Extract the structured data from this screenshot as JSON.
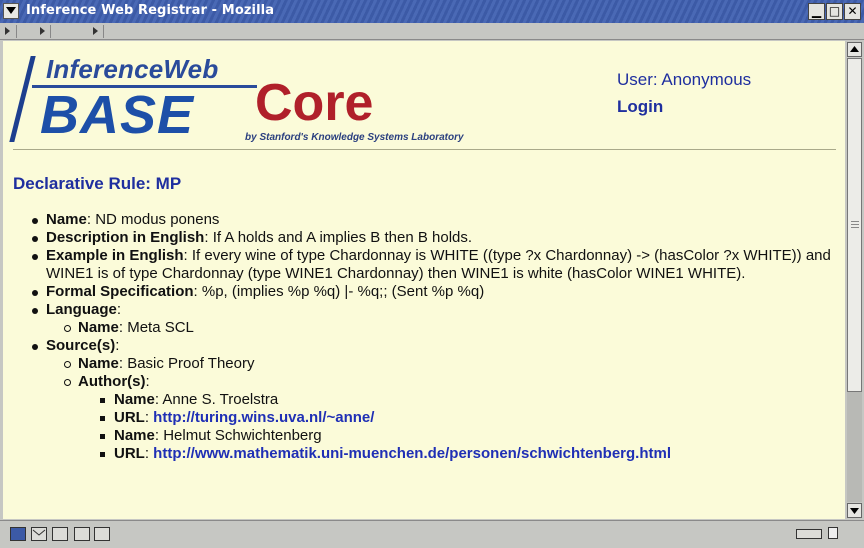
{
  "window": {
    "title": "Inference Web Registrar - Mozilla",
    "min_glyph": "▁",
    "max_glyph": "□",
    "close_glyph": "✕"
  },
  "header": {
    "logo_text_top": "InferenceWeb",
    "logo_text_base": "BASE",
    "logo_text_core": "Core",
    "logo_tagline": "by Stanford's Knowledge Systems Laboratory",
    "user": "User: Anonymous",
    "login": "Login"
  },
  "page": {
    "heading": "Declarative Rule: MP",
    "name_label": "Name",
    "name_value": ": ND modus ponens",
    "desc_label": "Description in English",
    "desc_value": ": If A holds and A implies B then B holds.",
    "example_label": "Example in English",
    "example_value": ": If every wine of type Chardonnay is WHITE ((type ?x Chardonnay) -> (hasColor ?x WHITE)) and WINE1 is of type Chardonnay (type WINE1 Chardonnay) then WINE1 is white (hasColor WINE1 WHITE).",
    "formal_label": "Formal Specification",
    "formal_value": ": %p, (implies %p %q) |- %q;; (Sent %p %q)",
    "language_label": "Language",
    "language_colon": ":",
    "language_name_label": "Name",
    "language_name_value": ": Meta SCL",
    "source_label": "Source(s)",
    "source_colon": ":",
    "source_name_label": "Name",
    "source_name_value": ": Basic Proof Theory",
    "authors_label": "Author(s)",
    "authors_colon": ":",
    "authors": [
      {
        "name_label": "Name",
        "name_value": ": Anne S. Troelstra",
        "url_label": "URL",
        "url_sep": ": ",
        "url": "http://turing.wins.uva.nl/~anne/"
      },
      {
        "name_label": "Name",
        "name_value": ": Helmut Schwichtenberg",
        "url_label": "URL",
        "url_sep": ": ",
        "url": "http://www.mathematik.uni-muenchen.de/personen/schwichtenberg.html"
      }
    ]
  },
  "colors": {
    "content_bg": "#fbfbd9",
    "link": "#1f2fb5",
    "heading": "#1f2f9f",
    "logo_red": "#b0202a",
    "logo_blue": "#1d4fa8"
  },
  "status_icons": [
    "navigator-icon",
    "mail-icon",
    "composer-icon",
    "addressbook-icon",
    "chat-icon"
  ]
}
